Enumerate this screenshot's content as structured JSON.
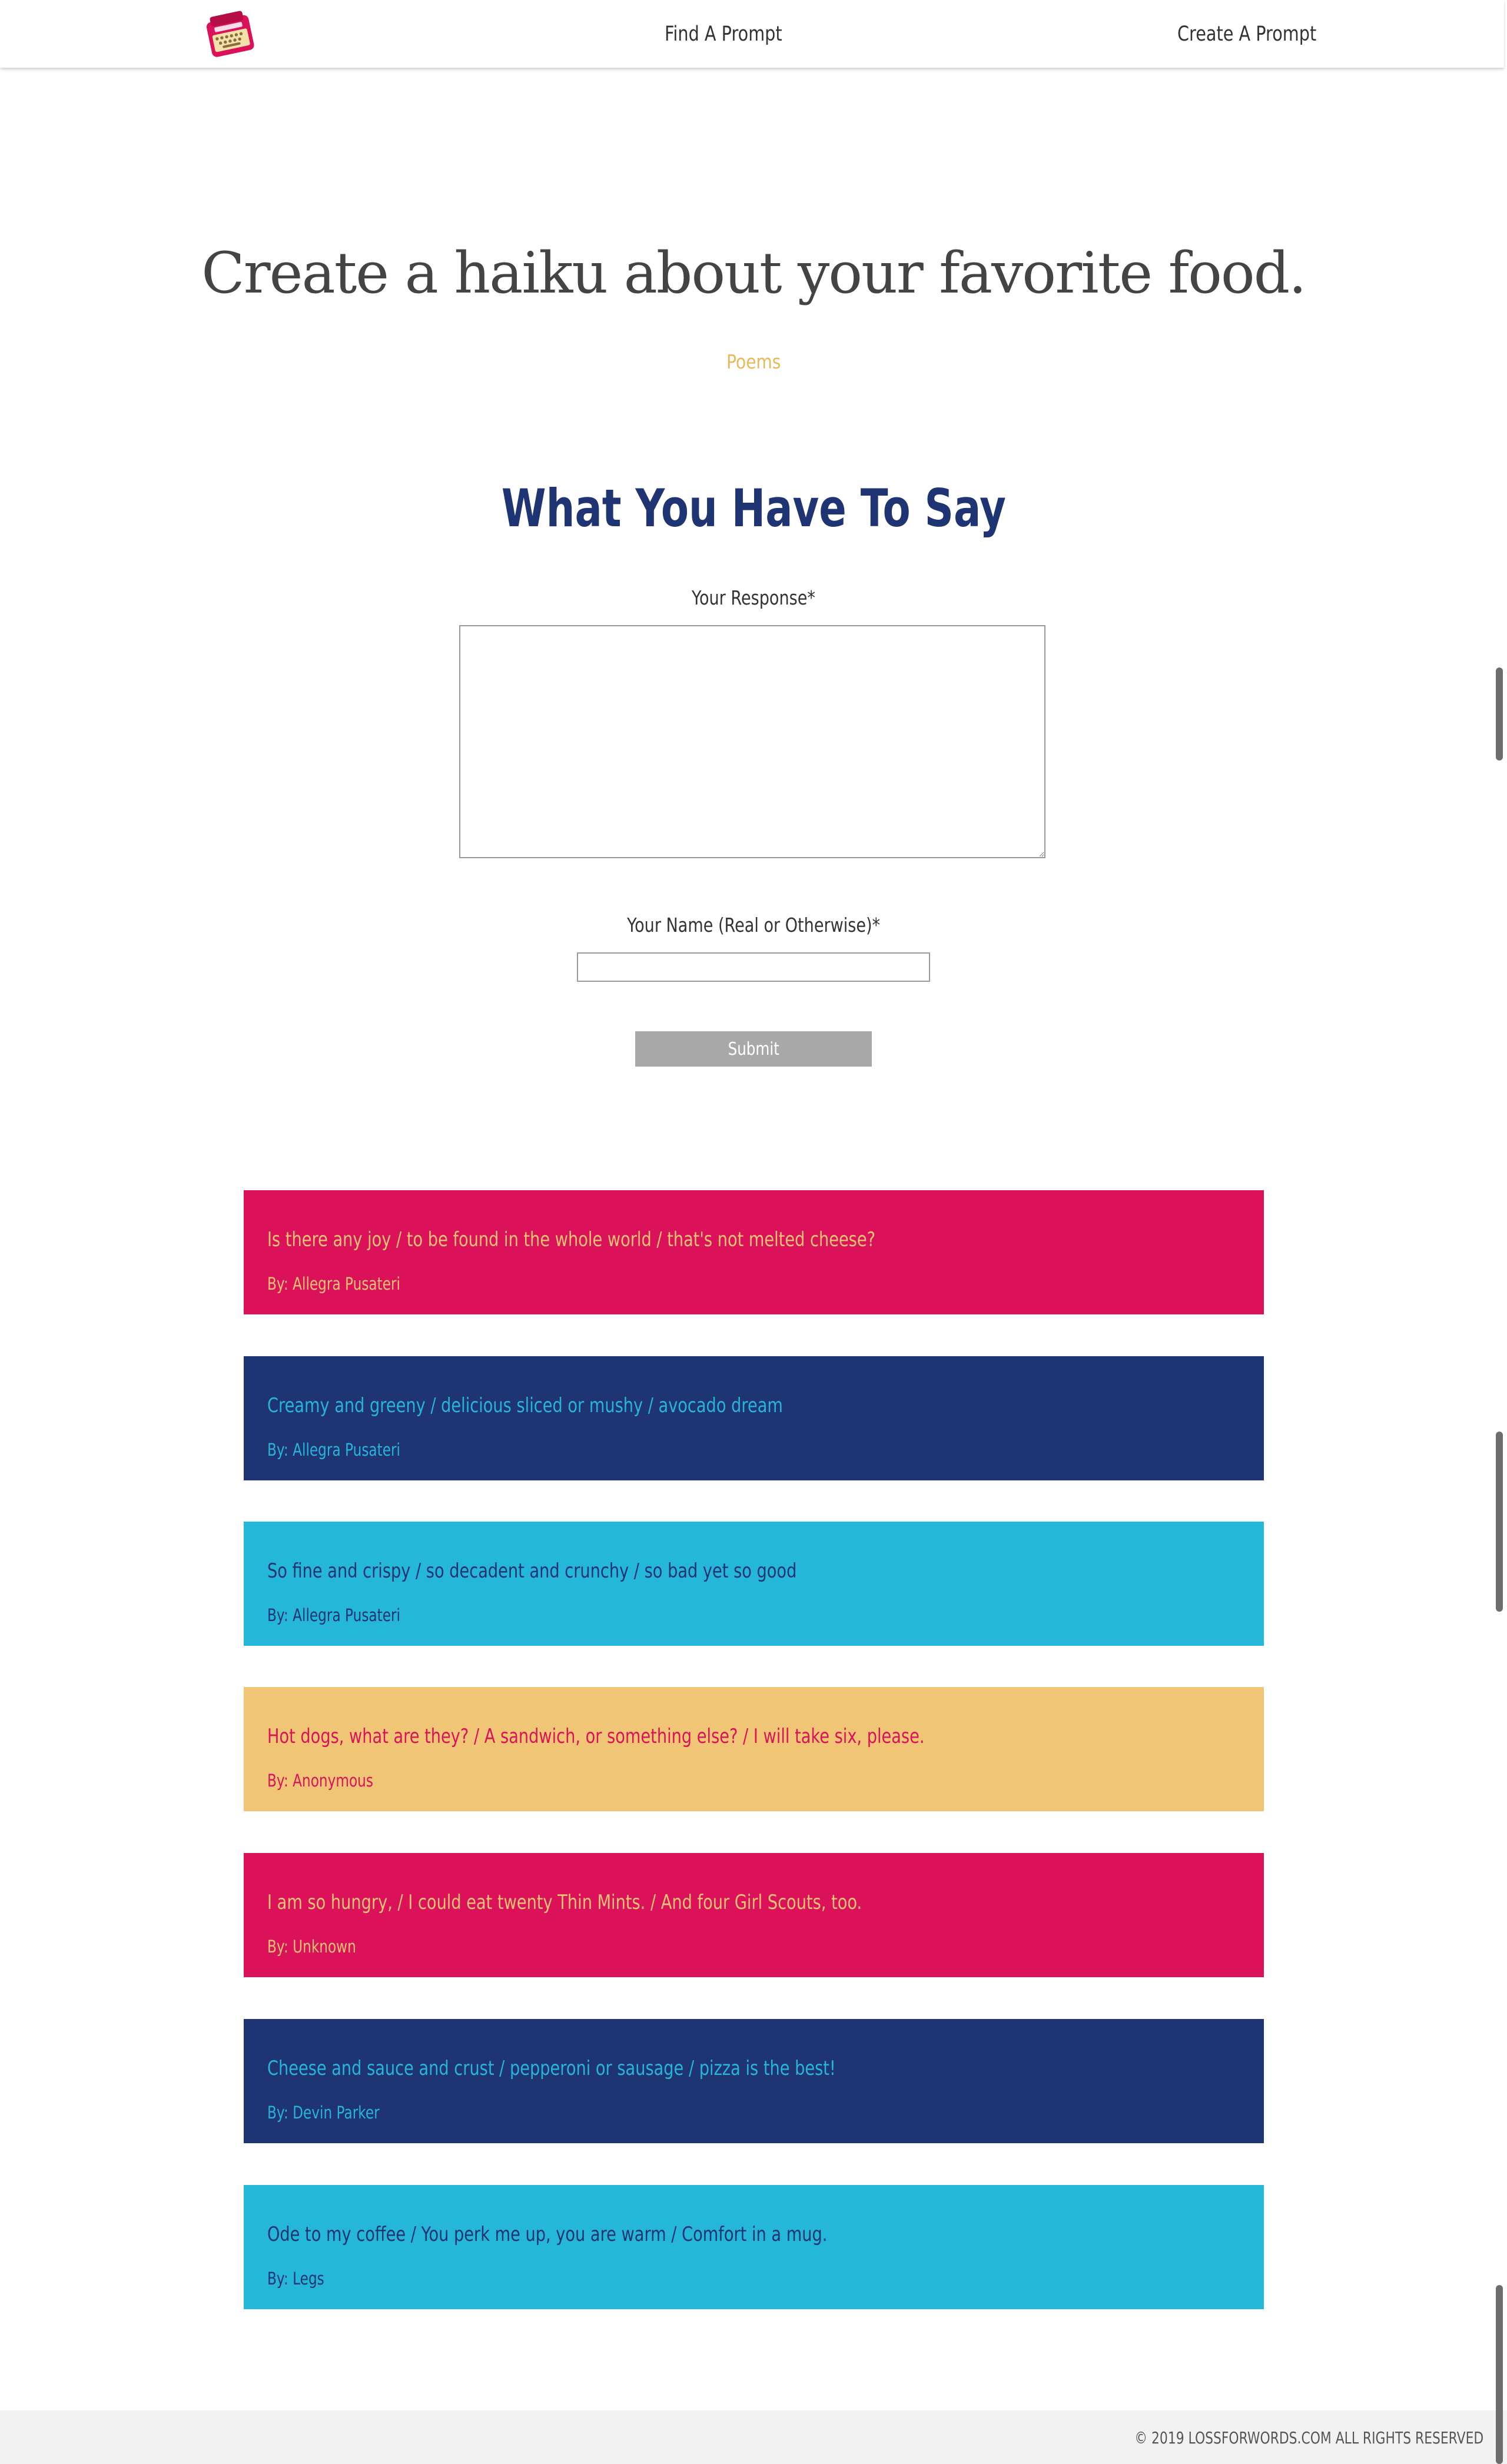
{
  "header": {
    "logo_icon": "typewriter-icon",
    "nav": [
      {
        "label": "Find A Prompt"
      },
      {
        "label": "Create A Prompt"
      }
    ]
  },
  "prompt": {
    "title": "Create a haiku about your favorite food.",
    "category": "Poems"
  },
  "form": {
    "heading": "What You Have To Say",
    "response_label": "Your Response*",
    "response_value": "",
    "name_label": "Your Name (Real or Otherwise)*",
    "name_value": "",
    "submit_label": "Submit"
  },
  "responses": [
    {
      "text": "Is there any joy / to be found in the whole world / that's not melted cheese?",
      "author": "By: Allegra Pusateri"
    },
    {
      "text": "Creamy and greeny / delicious sliced or mushy / avocado dream",
      "author": "By: Allegra Pusateri"
    },
    {
      "text": "So fine and crispy / so decadent and crunchy / so bad yet so good",
      "author": "By: Allegra Pusateri"
    },
    {
      "text": "Hot dogs, what are they? / A sandwich, or something else? / I will take six, please.",
      "author": "By: Anonymous"
    },
    {
      "text": "I am so hungry, / I could eat twenty Thin Mints. / And four Girl Scouts, too.",
      "author": "By: Unknown"
    },
    {
      "text": "Cheese and sauce and crust / pepperoni or sausage / pizza is the best!",
      "author": "By: Devin Parker"
    },
    {
      "text": "Ode to my coffee / You perk me up, you are warm / Comfort in a mug.",
      "author": "By: Legs"
    }
  ],
  "colors": {
    "pink": "#db1259",
    "navy": "#1f3472",
    "cyan": "#24b7da",
    "gold": "#f0c676"
  },
  "footer": {
    "text": "© 2019 LOSSFORWORDS.COM ALL RIGHTS RESERVED"
  }
}
